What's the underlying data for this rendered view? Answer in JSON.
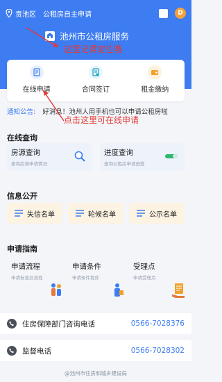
{
  "topbar": {
    "region": "贵池区",
    "title": "公租房自主申请"
  },
  "brand": {
    "name": "池州市公租房服务"
  },
  "annotations": {
    "a1": "这里记得定位哦",
    "a2": "点击这里可在线申请"
  },
  "services": [
    {
      "label": "在线申请",
      "icon": "edit-doc-icon"
    },
    {
      "label": "合同签订",
      "icon": "contract-icon"
    },
    {
      "label": "租金缴纳",
      "icon": "wallet-icon"
    }
  ],
  "notice": {
    "label": "通知公告:",
    "text": "好消息！池州人用手机也可以申请公租房啦"
  },
  "online_query": {
    "title": "在线查询",
    "items": [
      {
        "title": "房源查询",
        "subtitle": "查询房源申请情况"
      },
      {
        "title": "进度查询",
        "subtitle": "查询公租房申请进度"
      }
    ]
  },
  "info": {
    "title": "信息公开",
    "items": [
      {
        "label": "失信名单"
      },
      {
        "label": "轮候名单"
      },
      {
        "label": "公示名单"
      }
    ]
  },
  "guide": {
    "title": "申请指南",
    "items": [
      {
        "title": "申请流程",
        "subtitle": "申请标准及流程"
      },
      {
        "title": "申请条件",
        "subtitle": "申请条件程序"
      },
      {
        "title": "受理点",
        "subtitle": "申请受理点"
      }
    ]
  },
  "phones": [
    {
      "label": "住房保障部门咨询电话",
      "number": "0566-7028376"
    },
    {
      "label": "监督电话",
      "number": "0566-7028302"
    }
  ],
  "footer": "@池州市住房和城乡建设局",
  "colors": {
    "primary": "#3d7cf1",
    "annotation": "#e53935",
    "list_bg": "#fdf3e3"
  }
}
